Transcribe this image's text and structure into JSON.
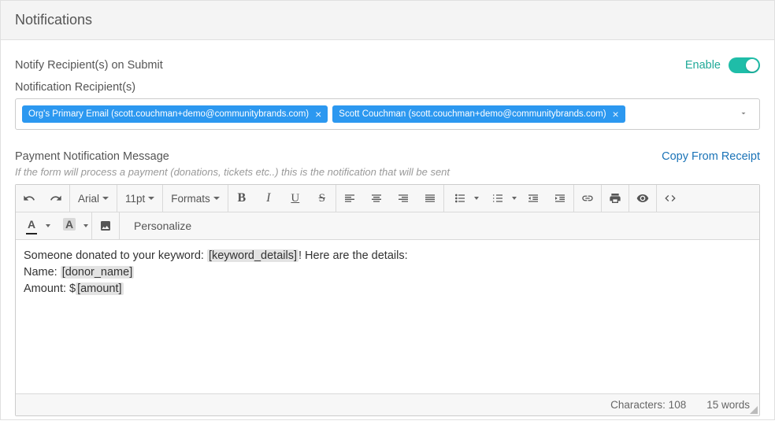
{
  "panel": {
    "title": "Notifications"
  },
  "notify": {
    "label": "Notify Recipient(s) on Submit",
    "enable_text": "Enable",
    "recipients_label": "Notification Recipient(s)",
    "tags": [
      {
        "text": "Org's Primary Email (scott.couchman+demo@communitybrands.com)"
      },
      {
        "text": "Scott Couchman (scott.couchman+demo@communitybrands.com)"
      }
    ]
  },
  "message": {
    "label": "Payment Notification Message",
    "copy_link": "Copy From Receipt",
    "help": "If the form will process a payment (donations, tickets etc..) this is the notification that will be sent"
  },
  "toolbar": {
    "font": "Arial",
    "size": "11pt",
    "formats": "Formats",
    "personalize": "Personalize"
  },
  "body": {
    "line1_pre": "Someone donated to your keyword: ",
    "line1_ph": "[keyword_details]",
    "line1_post": "! Here are the details:",
    "line2_pre": "Name: ",
    "line2_ph": "[donor_name]",
    "line3_pre": "Amount: $",
    "line3_ph": "[amount]"
  },
  "status": {
    "chars": "Characters: 108",
    "words": "15 words"
  }
}
